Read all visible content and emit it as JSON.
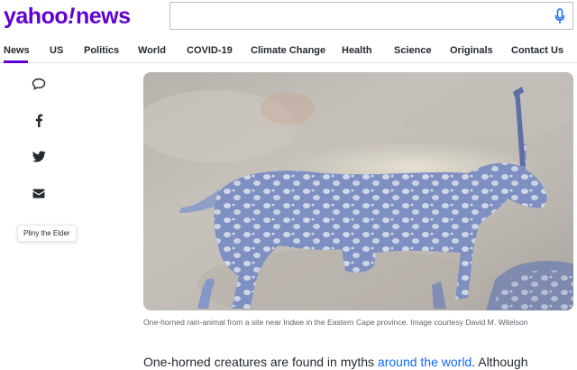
{
  "header": {
    "logo": {
      "yahoo": "yahoo",
      "bang": "!",
      "news": "news"
    },
    "search": {
      "value": "",
      "placeholder": ""
    },
    "brand_color": "#6001d2",
    "mic_icon": "microphone-icon"
  },
  "nav": {
    "active": "News",
    "items": [
      "News",
      "US",
      "Politics",
      "World",
      "COVID-19",
      "Climate Change",
      "Health",
      "Science",
      "Originals",
      "Contact Us"
    ]
  },
  "share": {
    "icons": [
      "comment-icon",
      "facebook-icon",
      "twitter-icon",
      "mail-icon"
    ],
    "tooltip": "Pliny the Elder"
  },
  "article": {
    "image_alt": "Rock painting of a one-horned rain-animal",
    "caption": "One-horned rain-animal from a site near Indwe in the Eastern Cape province. Image courtesy David M. Witelson",
    "body_before_link": "One-horned creatures are found in myths ",
    "body_link": "around the world",
    "body_after_link": ". Although",
    "link_color": "#0f69ff"
  }
}
